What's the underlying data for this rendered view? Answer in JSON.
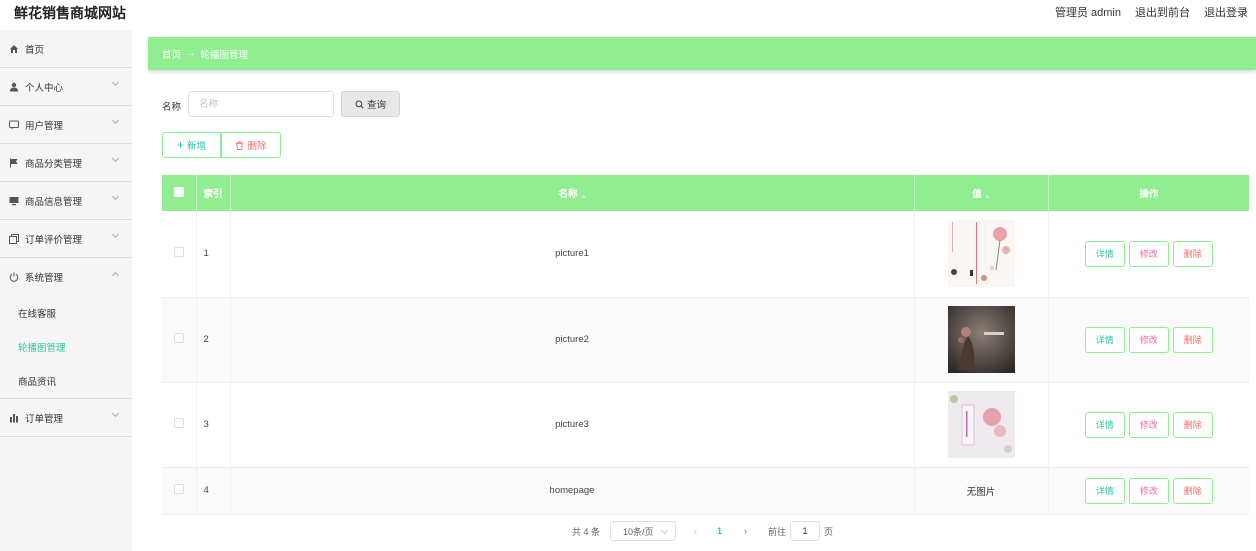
{
  "header": {
    "title": "鲜花销售商城网站",
    "user": "管理员 admin",
    "to_front": "退出到前台",
    "logout": "退出登录"
  },
  "sidebar": {
    "items": [
      {
        "label": "首页",
        "icon": "home-icon"
      },
      {
        "label": "个人中心",
        "icon": "user-icon"
      },
      {
        "label": "用户管理",
        "icon": "chat-icon"
      },
      {
        "label": "商品分类管理",
        "icon": "flag-icon"
      },
      {
        "label": "商品信息管理",
        "icon": "monitor-icon"
      },
      {
        "label": "订单评价管理",
        "icon": "copy-icon"
      },
      {
        "label": "系统管理",
        "icon": "power-icon"
      },
      {
        "label": "订单管理",
        "icon": "bar-chart-icon"
      }
    ],
    "system_sub": [
      "在线客服",
      "轮播图管理",
      "商品资讯"
    ]
  },
  "breadcrumb": {
    "home": "首页",
    "arrow": "→",
    "current": "轮播图管理"
  },
  "search": {
    "label": "名称",
    "placeholder": "名称",
    "button": "查询"
  },
  "actions": {
    "add": "新增",
    "delete": "删除"
  },
  "table": {
    "headers": {
      "index": "索引",
      "name": "名称",
      "value": "值",
      "ops": "操作"
    },
    "rows": [
      {
        "index": "1",
        "name": "picture1",
        "value": ""
      },
      {
        "index": "2",
        "name": "picture2",
        "value": ""
      },
      {
        "index": "3",
        "name": "picture3",
        "value": ""
      },
      {
        "index": "4",
        "name": "homepage",
        "value": "无图片"
      }
    ],
    "row_buttons": {
      "detail": "详情",
      "edit": "修改",
      "remove": "删除"
    }
  },
  "pagination": {
    "total": "共 4 条",
    "page_size": "10条/页",
    "current": "1",
    "goto": "前往",
    "jump_value": "1",
    "page_unit": "页"
  },
  "colors": {
    "accent": "#90ee90",
    "active_text": "#2ec6a0",
    "danger": "#f56c6c"
  }
}
